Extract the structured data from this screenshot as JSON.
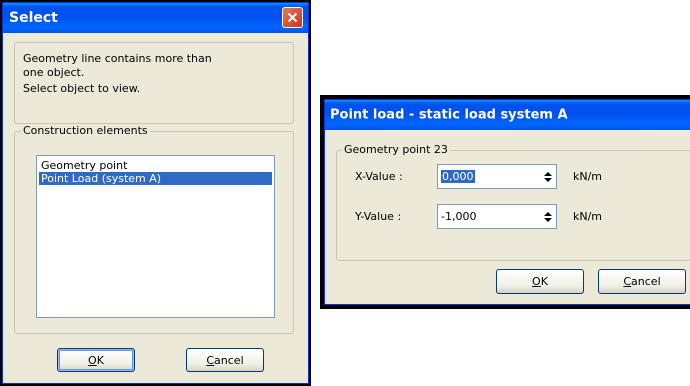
{
  "select_dialog": {
    "title": "Select",
    "message_line1": "Geometry line contains more than",
    "message_line2": "one object.",
    "message_line3": "Select object to view.",
    "group_label": "Construction elements",
    "items": [
      {
        "label": "Geometry point",
        "selected": false
      },
      {
        "label": "Point Load (system A)",
        "selected": true
      }
    ],
    "ok_accel": "O",
    "ok_rest": "K",
    "cancel_accel": "C",
    "cancel_rest": "ancel"
  },
  "load_dialog": {
    "title": "Point load - static load system A",
    "group_label": "Geometry point 23",
    "x_label": "X-Value :",
    "x_value": "0,000",
    "x_unit": "kN/m",
    "y_label": "Y-Value :",
    "y_value": "-1,000",
    "y_unit": "kN/m",
    "ok_accel": "O",
    "ok_rest": "K",
    "cancel_accel": "C",
    "cancel_rest": "ancel"
  },
  "colors": {
    "titlebar": "#0054e3",
    "dialog_bg": "#ece9d8",
    "selection": "#316ac5",
    "close_button": "#d2472a"
  }
}
